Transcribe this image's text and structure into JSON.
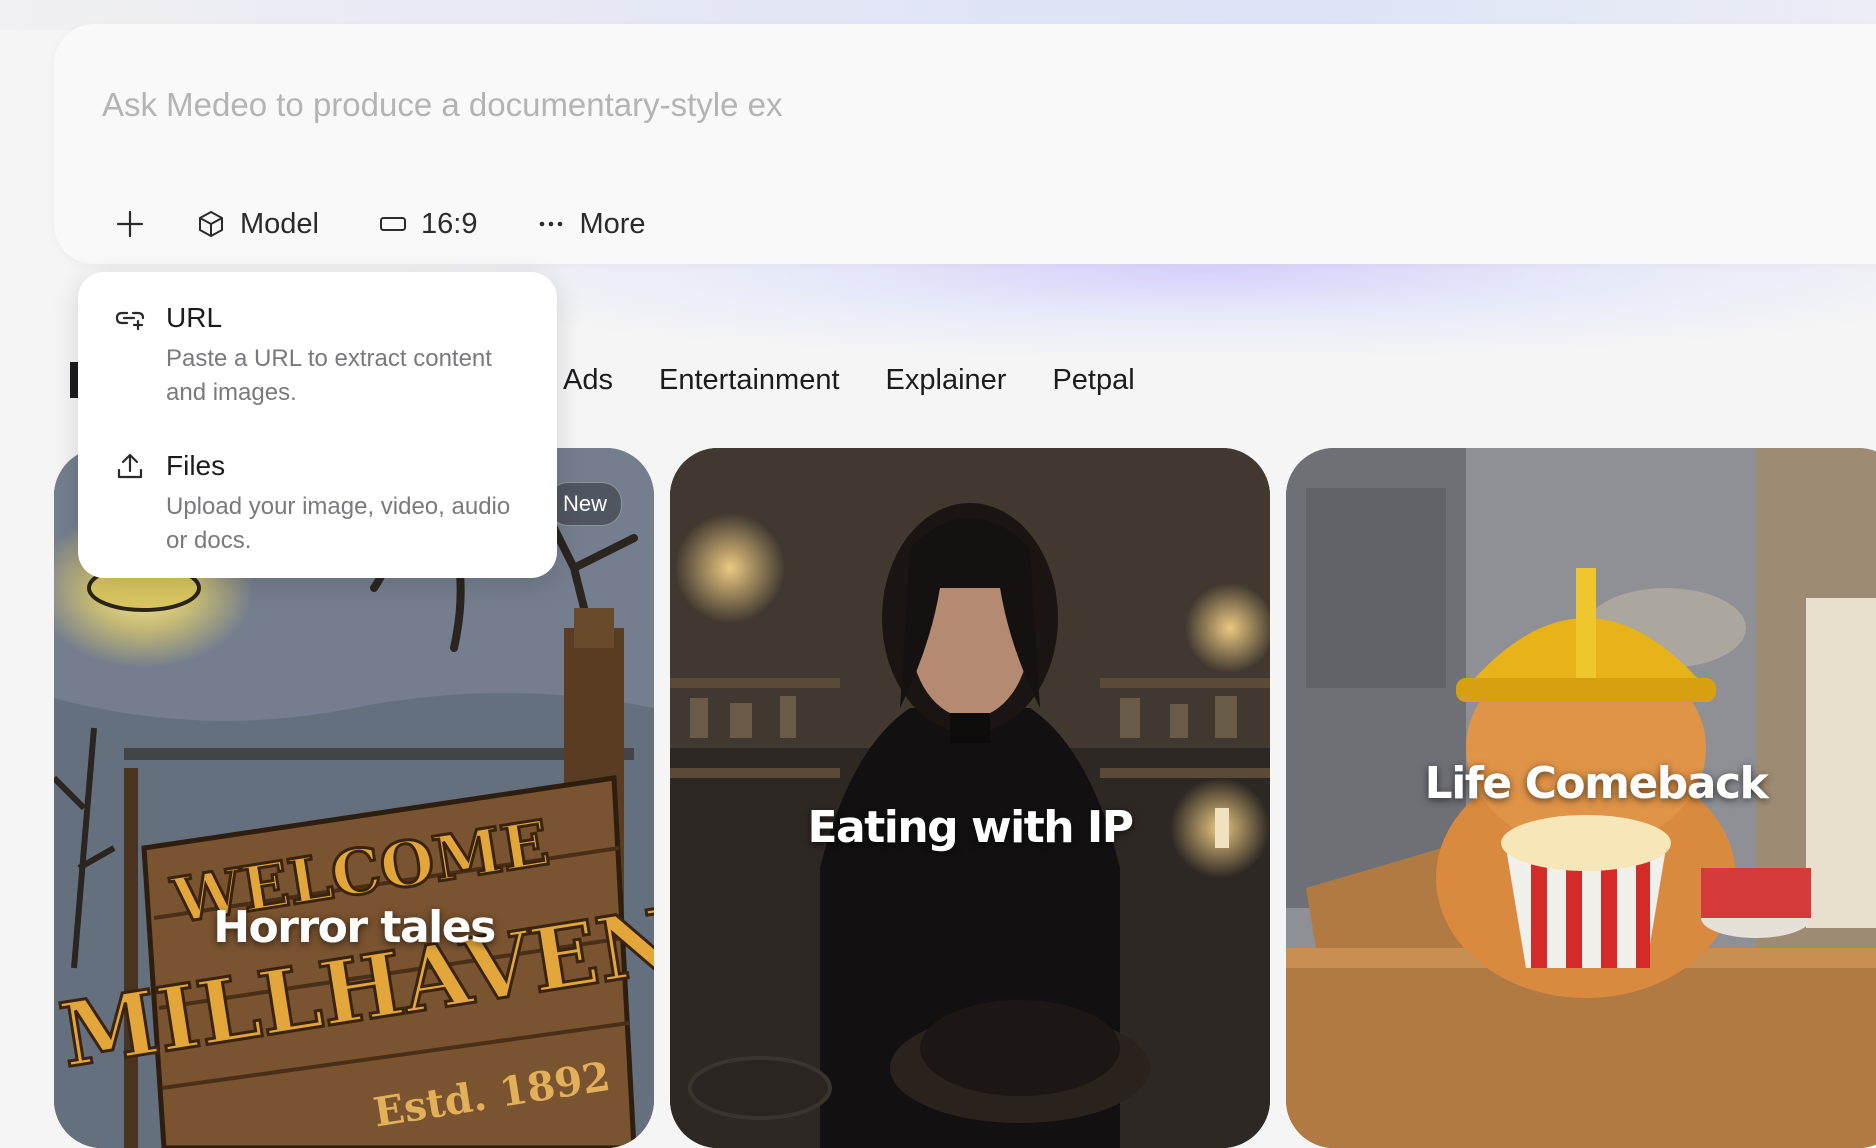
{
  "prompt": {
    "placeholder": "Ask Medeo to produce a documentary-style ex"
  },
  "toolbar": {
    "add_icon": "plus-icon",
    "model_label": "Model",
    "model_icon": "cube-icon",
    "ratio_label": "16:9",
    "ratio_icon": "rectangle-icon",
    "more_label": "More",
    "more_icon": "ellipsis-icon"
  },
  "tabs": [
    {
      "label": "Ads"
    },
    {
      "label": "Entertainment"
    },
    {
      "label": "Explainer"
    },
    {
      "label": "Petpal"
    }
  ],
  "cards": [
    {
      "title": "Horror tales",
      "badge": "New",
      "sign_line1": "WELCOME",
      "sign_line2": "MILLHAVEN",
      "sign_line3": "Estd. 1892"
    },
    {
      "title": "Eating with IP"
    },
    {
      "title": "Life Comeback"
    }
  ],
  "dropdown": {
    "items": [
      {
        "title": "URL",
        "description": "Paste a URL to extract content and images.",
        "icon": "link-icon"
      },
      {
        "title": "Files",
        "description": "Upload your image, video, audio or docs.",
        "icon": "upload-icon"
      }
    ]
  },
  "colors": {
    "background": "#f5f5f6",
    "prompt_box": "#f9f9f9",
    "text": "#1c1c1e",
    "muted": "#7a7a7e",
    "placeholder": "#b4b4b4"
  }
}
